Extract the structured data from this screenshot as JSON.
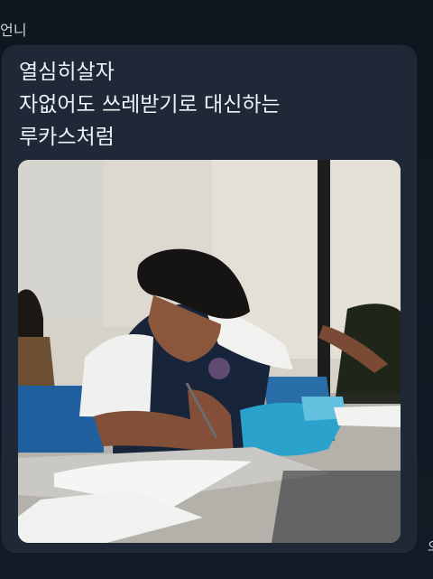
{
  "chat": {
    "sender_name": "언니",
    "message": "열심히살자\n자없어도 쓰레받기로 대신하는\n루카스처럼",
    "edge_glyph": "오"
  },
  "photo": {
    "alt": "student writing at desk with blue dustpan"
  }
}
